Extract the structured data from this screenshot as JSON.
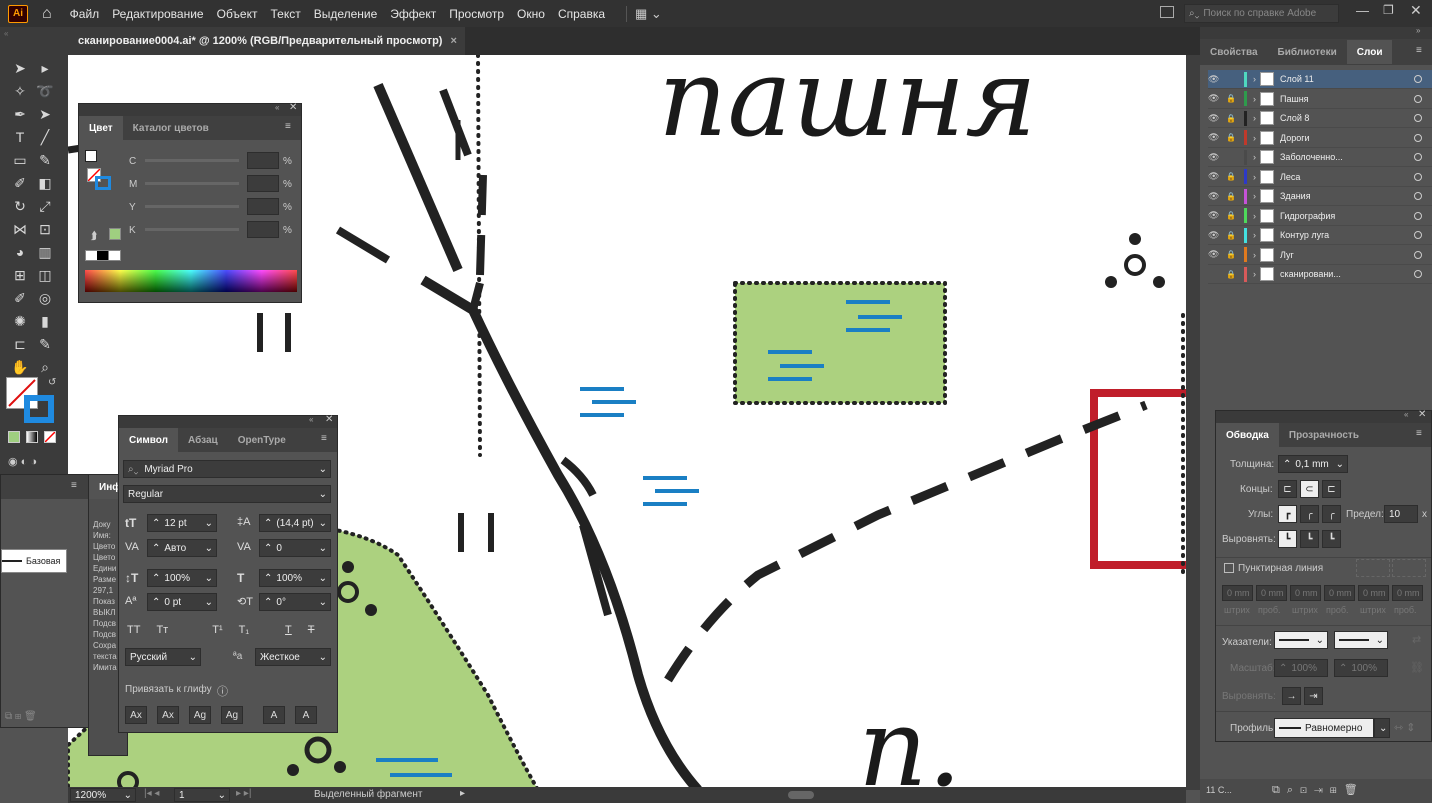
{
  "app": {
    "logo": "Ai"
  },
  "menu": [
    "Файл",
    "Редактирование",
    "Объект",
    "Текст",
    "Выделение",
    "Эффект",
    "Просмотр",
    "Окно",
    "Справка"
  ],
  "search": {
    "placeholder": "Поиск по справке Adobe"
  },
  "doc_tab": {
    "title": "сканирование0004.ai* @ 1200% (RGB/Предварительный просмотр)",
    "close": "×"
  },
  "canvas": {
    "title": "пашня",
    "bottom_text": "п."
  },
  "color_panel": {
    "tabs": [
      "Цвет",
      "Каталог цветов"
    ],
    "channels": [
      "C",
      "M",
      "Y",
      "K"
    ],
    "unit": "%"
  },
  "char_panel": {
    "tabs": [
      "Символ",
      "Абзац",
      "OpenType"
    ],
    "font": "Myriad Pro",
    "style": "Regular",
    "size": "12 pt",
    "leading": "(14,4 pt)",
    "kerning": "Авто",
    "tracking": "0",
    "vscale": "100%",
    "hscale": "100%",
    "baseline": "0 pt",
    "rotation": "0°",
    "language": "Русский",
    "aa": "Жесткое",
    "snap_label": "Привязать к глифу"
  },
  "info_panel": {
    "tab": "Инф",
    "brush": "Базовая",
    "lines": [
      "Доку",
      "Имя:",
      "Цвето",
      "Цвето",
      "Едини",
      "Разме",
      "297,1",
      "Показ",
      "ВЫКЛ",
      "Подсв",
      "Подсв",
      "Сохра",
      "текста",
      "Имита"
    ]
  },
  "right_tabs": [
    "Свойства",
    "Библиотеки",
    "Слои"
  ],
  "layers": [
    {
      "name": "Слой 11",
      "color": "#4fd8c0",
      "selected": true,
      "locked": false
    },
    {
      "name": "Пашня",
      "color": "#2e9b4c",
      "locked": true
    },
    {
      "name": "Слой 8",
      "color": "#222222",
      "locked": true
    },
    {
      "name": "Дороги",
      "color": "#c0392b",
      "locked": true
    },
    {
      "name": "Заболоченно...",
      "color": "#4a4a4a",
      "locked": false
    },
    {
      "name": "Леса",
      "color": "#2d39c8",
      "locked": true
    },
    {
      "name": "Здания",
      "color": "#c552d8",
      "locked": true
    },
    {
      "name": "Гидрография",
      "color": "#4ed95a",
      "locked": true
    },
    {
      "name": "Контур луга",
      "color": "#43e0e0",
      "locked": true
    },
    {
      "name": "Луг",
      "color": "#e07a1e",
      "locked": true
    },
    {
      "name": "сканировани...",
      "color": "#d85a5a",
      "locked": true
    }
  ],
  "layers_footer": "11 С...",
  "stroke_panel": {
    "tabs": [
      "Обводка",
      "Прозрачность"
    ],
    "weight_label": "Толщина:",
    "weight": "0,1 mm",
    "caps_label": "Концы:",
    "corners_label": "Углы:",
    "limit_label": "Предел:",
    "limit": "10",
    "limit_unit": "x",
    "align_label": "Выровнять:",
    "dashed_label": "Пунктирная линия",
    "dash_labels": [
      "штрих",
      "проб.",
      "штрих",
      "проб.",
      "штрих",
      "проб."
    ],
    "dash_value": "0 mm",
    "arrows_label": "Указатели:",
    "scale_label": "Масштаб:",
    "scale": "100%",
    "align2_label": "Выровнять:",
    "profile_label": "Профиль:",
    "profile": "Равномерно"
  },
  "status": {
    "zoom": "1200%",
    "artboard": "1",
    "mode": "Выделенный фрагмент"
  }
}
